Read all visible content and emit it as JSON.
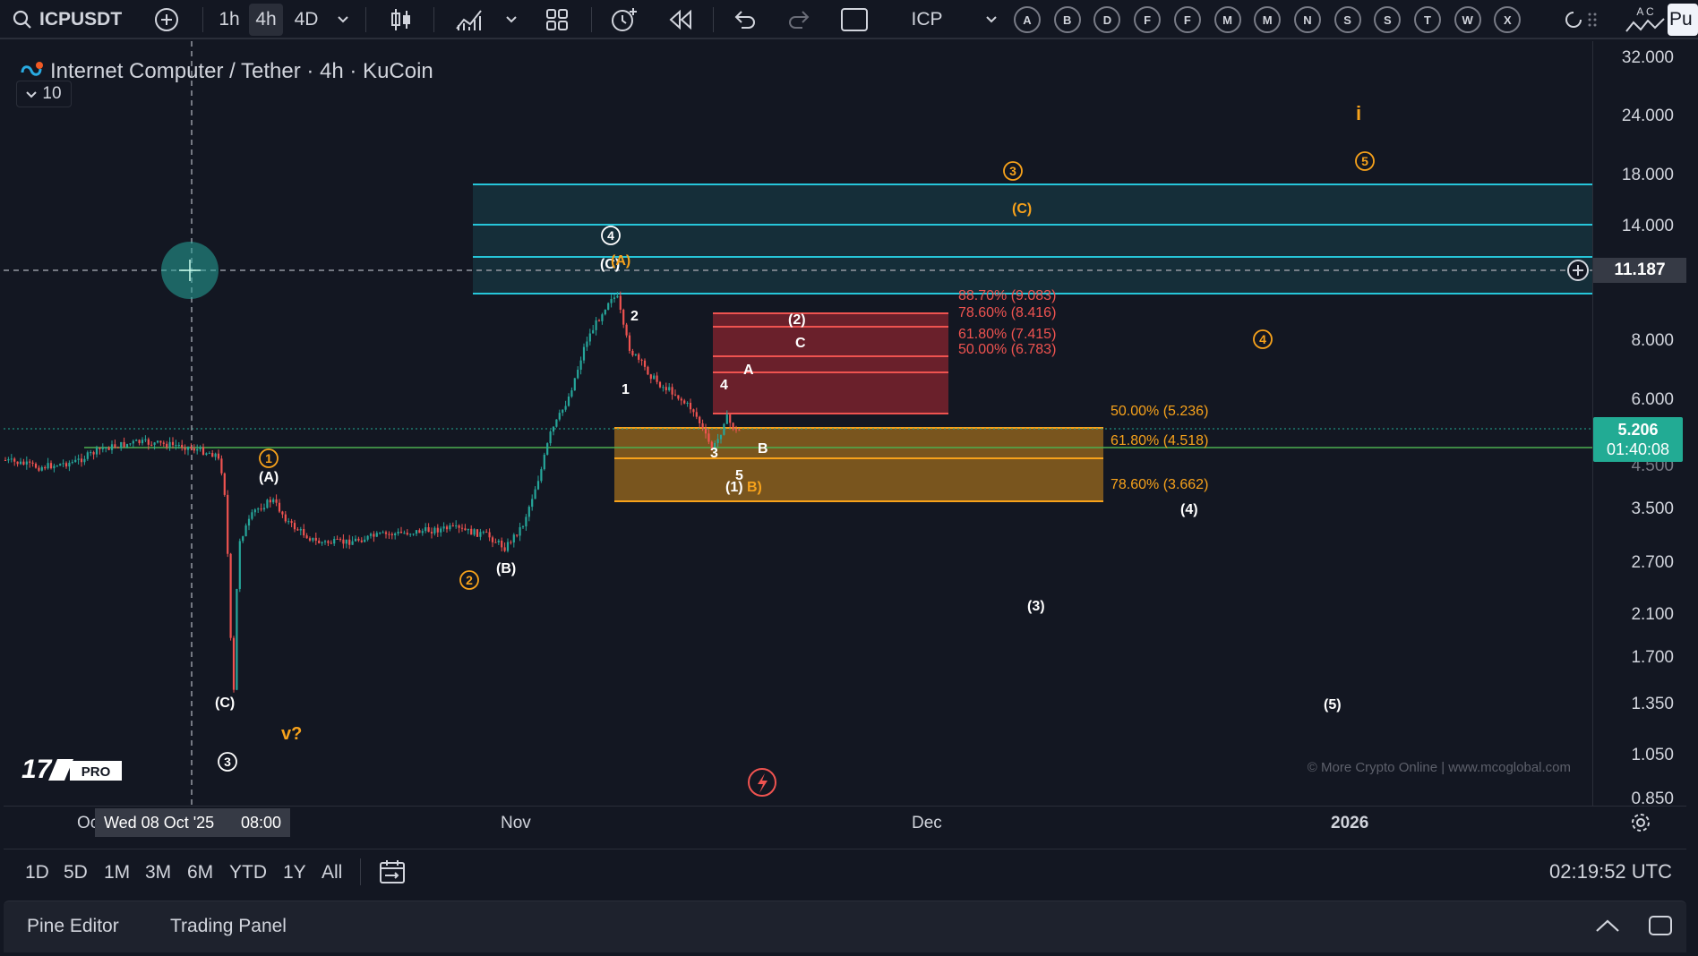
{
  "toolbar": {
    "symbol": "ICPUSDT",
    "intervals": [
      "1h",
      "4h",
      "4D"
    ],
    "active_interval": "4h",
    "watch_symbol": "ICP",
    "alert_letters": [
      "A",
      "B",
      "D",
      "F",
      "F",
      "M",
      "M",
      "N",
      "S",
      "S",
      "T",
      "W",
      "X"
    ],
    "right_partial_text": "Pu",
    "right_mini_letters": "A C"
  },
  "legend": {
    "pair": "Internet Computer / Tether · 4h · KuCoin",
    "indicator_count": "10"
  },
  "price_scale": {
    "labels": [
      "32.000",
      "24.000",
      "18.000",
      "14.000",
      "8.000",
      "6.000",
      "3.500",
      "2.700",
      "2.100",
      "1.700",
      "1.350",
      "1.050",
      "0.850"
    ],
    "partial_label": "4.500",
    "crosshair_price": "11.187",
    "last_price": "5.206",
    "countdown": "01:40:08",
    "last_price_color": "#22ab94"
  },
  "time_scale": {
    "labels": [
      "Oc",
      "Nov",
      "Dec",
      "2026"
    ],
    "crosshair_date": "Wed 08 Oct '25",
    "crosshair_time": "08:00"
  },
  "fib_levels": {
    "upper": [
      "88.70% (9.083)",
      "78.60% (8.416)",
      "61.80% (7.415)",
      "50.00% (6.783)"
    ],
    "lower": [
      "50.00% (5.236)",
      "61.80% (4.518)",
      "78.60% (3.662)"
    ]
  },
  "wave_labels": {
    "white": [
      "(A)",
      "(B)",
      "(C)",
      "(C)",
      "(2)",
      "C",
      "A",
      "B",
      "1",
      "2",
      "3",
      "4",
      "5",
      "(1)",
      "(3)",
      "(4)",
      "(5)"
    ],
    "white_circled": [
      "4",
      "3"
    ],
    "orange": [
      "(C)",
      "(A)",
      "B)",
      "v?",
      "i"
    ],
    "orange_circled": [
      "1",
      "2",
      "3",
      "4",
      "5"
    ]
  },
  "watermark": "© More Crypto Online  |  www.mcoglobal.com",
  "logo_badge": "PRO",
  "ranges": [
    "1D",
    "5D",
    "1M",
    "3M",
    "6M",
    "YTD",
    "1Y",
    "All"
  ],
  "utc_time": "02:19:52 UTC",
  "panel_tabs": [
    "Pine Editor",
    "Trading Panel"
  ],
  "colors": {
    "background": "#131722",
    "cyan_lines": "#26c6da",
    "upper_box": "#b22833",
    "lower_box": "#f7a21b",
    "orange_labels": "#f7a21b",
    "candle_up": "#26a69a",
    "candle_down": "#ef5350",
    "horizontal_green": "#4caf50"
  }
}
